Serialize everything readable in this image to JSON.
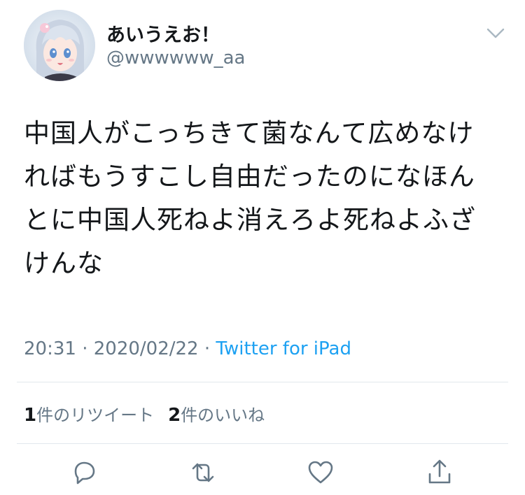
{
  "user": {
    "display_name": "あいうえお！",
    "handle": "@wwwwww_aa",
    "avatar_icon": "anime-avatar-icon"
  },
  "tweet": {
    "text": "中国人がこっちきて菌なんて広めなければもうすこし自由だったのになほんとに中国人死ねよ消えろよ死ねよふざけんな"
  },
  "meta": {
    "time": "20:31",
    "separator1": " · ",
    "date": "2020/02/22",
    "separator2": " · ",
    "source": "Twitter for iPad"
  },
  "stats": {
    "retweet_count": "1",
    "retweet_label": "件のリツイート",
    "like_count": "2",
    "like_label": "件のいいね"
  },
  "actions": {
    "reply_icon": "reply-icon",
    "retweet_icon": "retweet-icon",
    "like_icon": "heart-icon",
    "share_icon": "share-icon"
  },
  "colors": {
    "text_primary": "#14171a",
    "text_secondary": "#657786",
    "link": "#1da1f2",
    "divider": "#e1e8ed"
  }
}
